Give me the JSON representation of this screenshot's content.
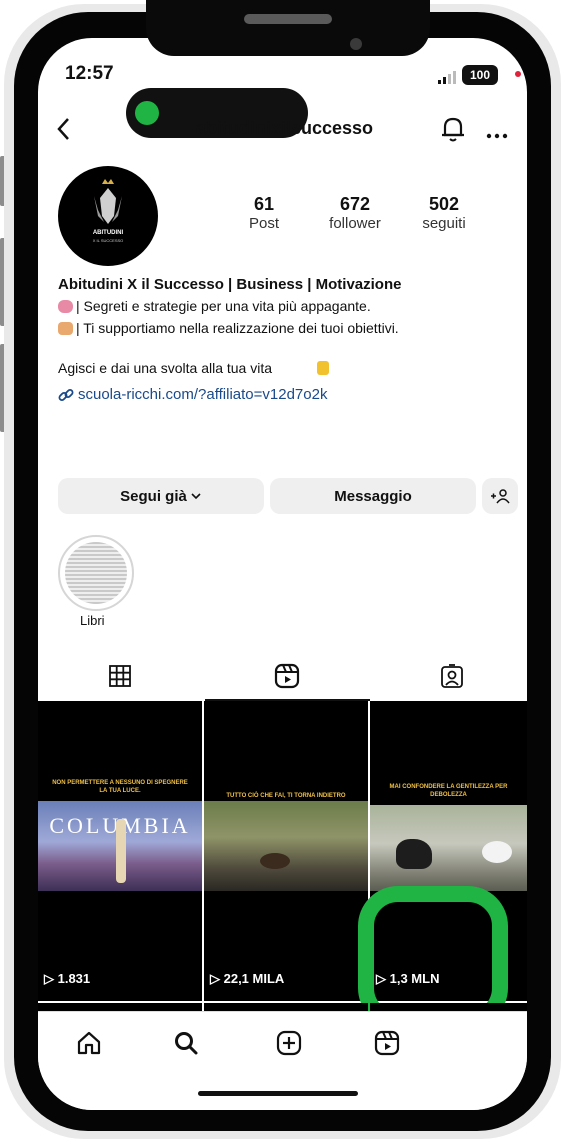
{
  "status_bar": {
    "time": "12:57",
    "battery": "100"
  },
  "header": {
    "username": "abitudinixilsuccesso"
  },
  "profile": {
    "avatar_text": "ABITUDINI",
    "avatar_subtext": "X IL SUCCESSO",
    "stats": [
      {
        "value": "61",
        "label": "Post"
      },
      {
        "value": "672",
        "label": "follower"
      },
      {
        "value": "502",
        "label": "seguiti"
      }
    ],
    "name": "Abitudini X il Successo | Business | Motivazione",
    "bio_line1": "| Segreti e strategie per una vita più appagante.",
    "bio_line2": "| Ti supportiamo nella realizzazione dei tuoi obiettivi.",
    "bio_line3": "Agisci e dai una svolta alla tua vita",
    "link": "scuola-ricchi.com/?affiliato=v12d7o2k"
  },
  "actions": {
    "follow_label": "Segui già",
    "message_label": "Messaggio"
  },
  "highlights": [
    {
      "label": "Libri"
    }
  ],
  "reels": [
    {
      "caption": "NON PERMETTERE A NESSUNO DI SPEGNERE LA TUA LUCE.",
      "views": "▷ 1.831",
      "art_text": "COLUMBIA"
    },
    {
      "caption": "TUTTO CIÒ CHE FAI, TI TORNA INDIETRO",
      "views": "▷ 22,1 MILA"
    },
    {
      "caption": "MAI CONFONDERE LA GENTILEZZA PER DEBOLEZZA",
      "views": "▷ 1,3 MLN"
    }
  ],
  "colors": {
    "link": "#1a4a8a",
    "highlight_ring": "#1fb443",
    "caption": "#f0c048"
  },
  "icons": [
    "back-icon",
    "bell-icon",
    "more-icon",
    "grid-icon",
    "reels-icon",
    "tagged-icon",
    "home-icon",
    "search-icon",
    "create-icon",
    "reels-nav-icon",
    "add-person-icon",
    "link-icon"
  ]
}
